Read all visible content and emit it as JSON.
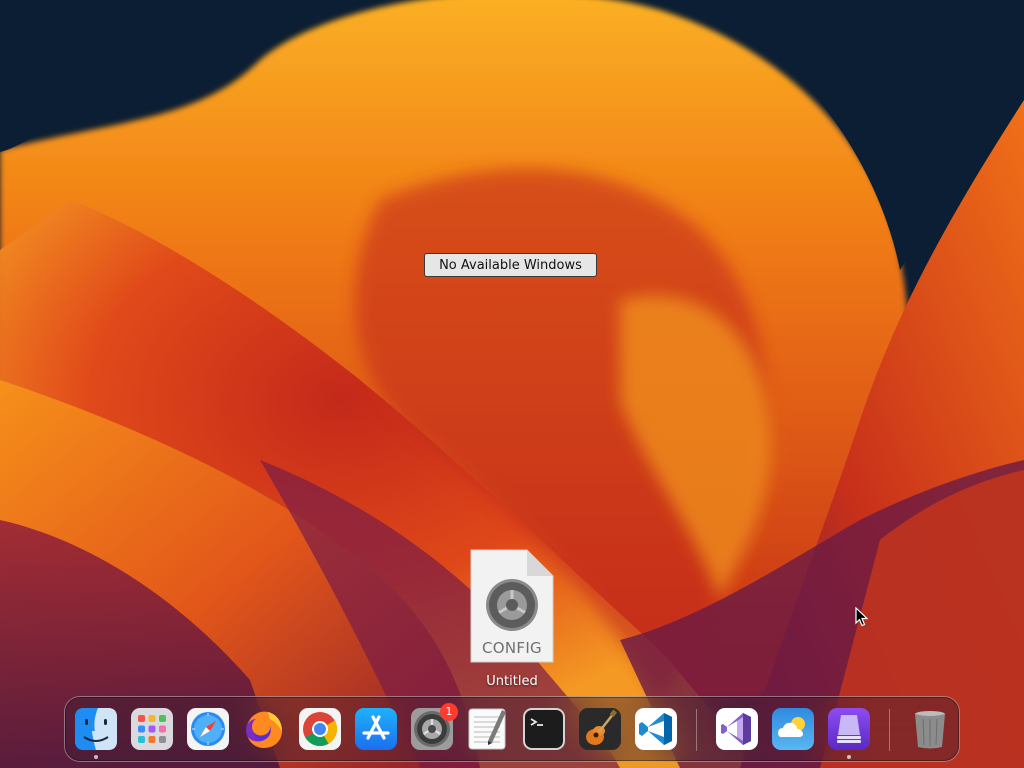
{
  "desktop": {
    "notice": "No Available Windows",
    "file": {
      "extension": "CONFIG",
      "name": "Untitled"
    }
  },
  "dock": {
    "apps": [
      {
        "id": "finder",
        "name": "Finder",
        "icon": "finder-icon",
        "running": true
      },
      {
        "id": "launchpad",
        "name": "Launchpad",
        "icon": "launchpad-icon"
      },
      {
        "id": "safari",
        "name": "Safari",
        "icon": "safari-icon"
      },
      {
        "id": "firefox",
        "name": "Firefox",
        "icon": "firefox-icon"
      },
      {
        "id": "chrome",
        "name": "Google Chrome",
        "icon": "chrome-icon"
      },
      {
        "id": "app-store",
        "name": "App Store",
        "icon": "app-store-icon"
      },
      {
        "id": "system-settings",
        "name": "System Settings",
        "icon": "gear-icon",
        "badge": "1"
      },
      {
        "id": "textedit",
        "name": "TextEdit",
        "icon": "textedit-icon"
      },
      {
        "id": "terminal",
        "name": "Terminal",
        "icon": "terminal-icon"
      },
      {
        "id": "garageband",
        "name": "GarageBand",
        "icon": "guitar-icon"
      },
      {
        "id": "vscode",
        "name": "Visual Studio Code",
        "icon": "vscode-icon"
      },
      {
        "id": "visual-studio",
        "name": "Visual Studio",
        "icon": "visual-studio-icon"
      },
      {
        "id": "weather",
        "name": "Weather",
        "icon": "weather-icon"
      },
      {
        "id": "simulator",
        "name": "Simulator",
        "icon": "simulator-icon",
        "running": true
      },
      {
        "id": "trash",
        "name": "Trash",
        "icon": "trash-icon"
      }
    ]
  },
  "colors": {
    "wallpaper_dark": "#0b1e33",
    "wallpaper_orange": "#f28a12",
    "wallpaper_red": "#d8341c",
    "wallpaper_purple": "#6a1e4c",
    "badge_red": "#ff3b30"
  }
}
